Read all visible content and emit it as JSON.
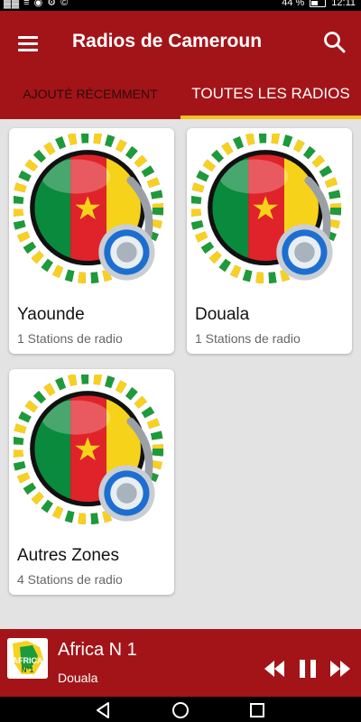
{
  "status_bar": {
    "left_icons": "▓▓ ≡ ◉ ⚙ ©",
    "battery": "44 %",
    "time": "12:11"
  },
  "app": {
    "title": "Radios de Cameroun",
    "brand_color": "#a31418",
    "accent_color": "#f4c21a"
  },
  "tabs": [
    {
      "label": "AJOUTÉ RÉCEMMENT",
      "selected": false
    },
    {
      "label": "TOUTES LES RADIOS",
      "selected": true
    }
  ],
  "regions": [
    {
      "name": "Yaounde",
      "count": "1 Stations de radio",
      "icon": "cameroon-flag-headphones-icon"
    },
    {
      "name": "Douala",
      "count": "1 Stations de radio",
      "icon": "cameroon-flag-headphones-icon"
    },
    {
      "name": "Autres Zones",
      "count": "4 Stations de radio",
      "icon": "cameroon-flag-headphones-icon"
    }
  ],
  "player": {
    "station": "Africa N 1",
    "city": "Douala",
    "logo_text_top": "AFRICA",
    "logo_text_bottom": "N°1",
    "state": "playing"
  },
  "icons": {
    "menu": "hamburger-menu-icon",
    "search": "search-icon",
    "prev": "rewind-icon",
    "pause": "pause-icon",
    "next": "fast-forward-icon"
  }
}
